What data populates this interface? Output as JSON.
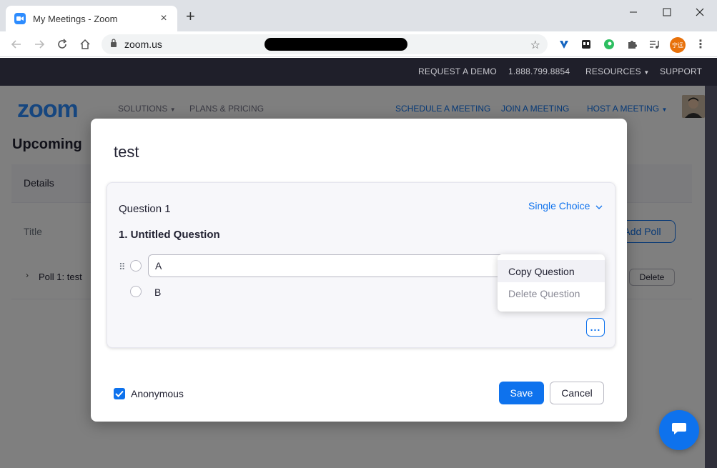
{
  "browser": {
    "tab_title": "My Meetings - Zoom",
    "url": "zoom.us",
    "ext_avatar_text": "宁远"
  },
  "topbar": {
    "request_demo": "REQUEST A DEMO",
    "phone": "1.888.799.8854",
    "resources": "RESOURCES",
    "support": "SUPPORT"
  },
  "mainnav": {
    "logo": "zoom",
    "solutions": "SOLUTIONS",
    "plans": "PLANS & PRICING",
    "schedule": "SCHEDULE A MEETING",
    "join": "JOIN A MEETING",
    "host": "HOST A MEETING"
  },
  "page": {
    "title": "Upcoming",
    "details_tab": "Details",
    "title_label": "Title",
    "add_poll": "Add Poll",
    "poll_name": "Poll 1: test",
    "delete": "Delete"
  },
  "modal": {
    "title": "test",
    "question_label": "Question 1",
    "question_type": "Single Choice",
    "question_text": "1. Untitled Question",
    "option_a": "A",
    "option_b": "B",
    "more": "...",
    "anonymous": "Anonymous",
    "save": "Save",
    "cancel": "Cancel"
  },
  "menu": {
    "copy": "Copy Question",
    "delete": "Delete Question"
  }
}
